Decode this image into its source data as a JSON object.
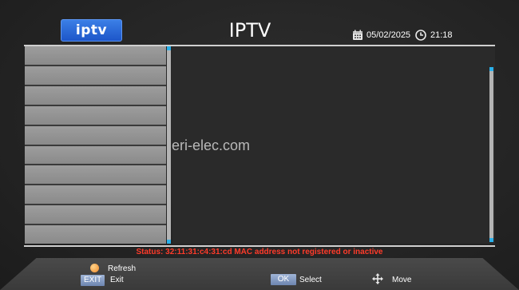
{
  "header": {
    "logo_text": "iptv",
    "title": "IPTV",
    "date": "05/02/2025",
    "time": "21:18",
    "calendar_icon": "calendar-icon",
    "clock_icon": "clock-icon"
  },
  "list": {
    "row_count": 10,
    "rows": [
      "",
      "",
      "",
      "",
      "",
      "",
      "",
      "",
      "",
      ""
    ]
  },
  "watermark": "eri-elec.com",
  "status": "Status: 32:11:31:c4:31:cd MAC address not registered or inactive",
  "footer": {
    "refresh_label": "Refresh",
    "exit_key": "EXIT",
    "exit_label": "Exit",
    "ok_key": "OK",
    "select_label": "Select",
    "move_label": "Move",
    "move_icon": "move-arrows-icon"
  },
  "colors": {
    "accent_blue": "#1d56c9",
    "status_red": "#ff3b2a",
    "scroll_cap": "#2ab0ea",
    "refresh_orange": "#f08a2a"
  }
}
